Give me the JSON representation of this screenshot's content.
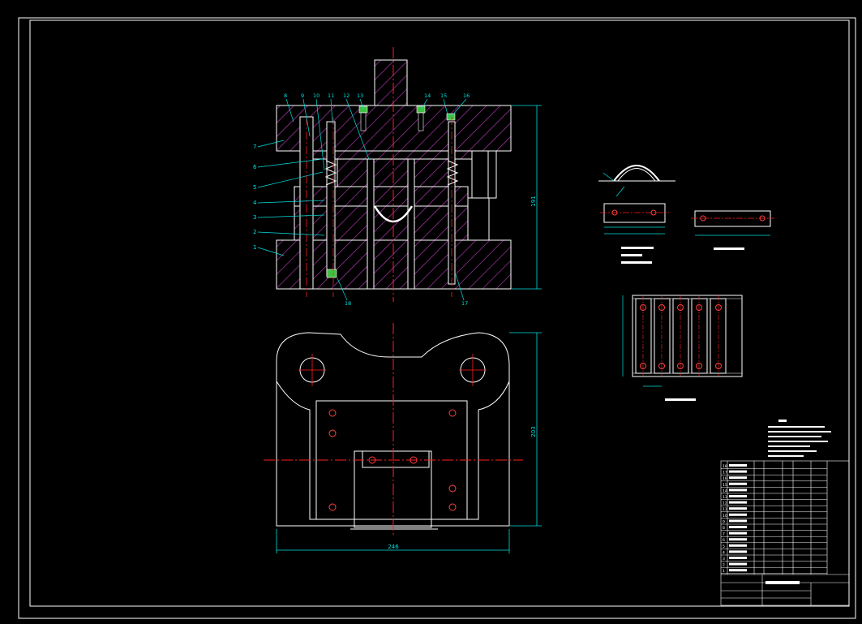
{
  "drawing": {
    "colors": {
      "background": "#000000",
      "border": "#ffffff",
      "outline": "#ffffff",
      "hatch": "#c040c0",
      "centerline": "#ff2020",
      "dimension": "#00e0e0",
      "leader": "#00e0e0",
      "label": "#00e0e0",
      "hole": "#ff2020",
      "highlight": "#40ff40"
    },
    "part_labels_left": [
      "7",
      "6",
      "5",
      "4",
      "3",
      "2",
      "1"
    ],
    "part_labels_top": [
      "8",
      "9",
      "10",
      "11",
      "12",
      "13",
      "14",
      "15",
      "16"
    ],
    "part_labels_bottom": [
      "18",
      "17"
    ],
    "front_view_height_dim": "191",
    "plan_view_width_dim": "246",
    "plan_view_height_dim": "203",
    "title_block": {
      "row_numbers": [
        "18",
        "17",
        "16",
        "15",
        "14",
        "13",
        "12",
        "11",
        "10",
        "9",
        "8",
        "7",
        "6",
        "5",
        "4",
        "3",
        "2",
        "1"
      ]
    }
  }
}
